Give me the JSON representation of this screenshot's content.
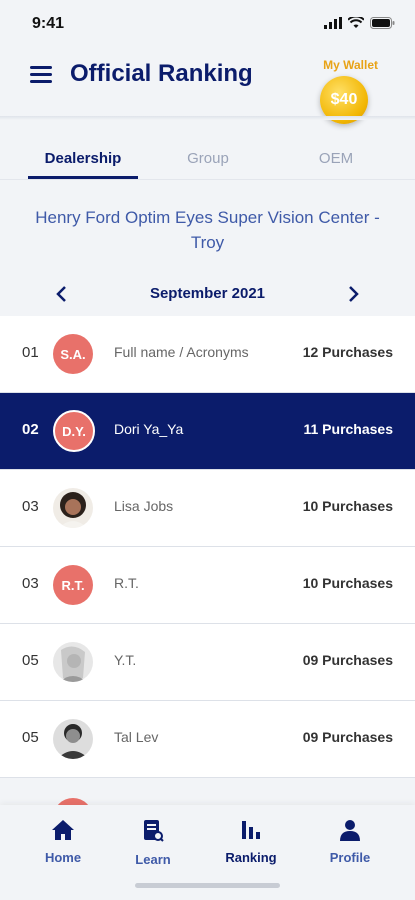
{
  "status": {
    "time": "9:41"
  },
  "header": {
    "title": "Official Ranking",
    "wallet_label": "My Wallet",
    "wallet_amount": "$40"
  },
  "tabs": [
    {
      "label": "Dealership",
      "active": true
    },
    {
      "label": "Group",
      "active": false
    },
    {
      "label": "OEM",
      "active": false
    }
  ],
  "dealer_name": "Henry Ford Optim Eyes Super Vision Center - Troy",
  "month": {
    "label": "September 2021",
    "prev_icon": "chevron-left-icon",
    "next_icon": "chevron-right-icon"
  },
  "rankings": [
    {
      "rank": "01",
      "avatar_text": "S.A.",
      "avatar_type": "initials",
      "name": "Full name / Acronyms",
      "purchases": "12 Purchases",
      "highlight": false
    },
    {
      "rank": "02",
      "avatar_text": "D.Y.",
      "avatar_type": "initials",
      "name": "Dori Ya_Ya",
      "purchases": "11 Purchases",
      "highlight": true
    },
    {
      "rank": "03",
      "avatar_text": "",
      "avatar_type": "photo",
      "name": "Lisa Jobs",
      "purchases": "10 Purchases",
      "highlight": false
    },
    {
      "rank": "03",
      "avatar_text": "R.T.",
      "avatar_type": "initials",
      "name": "R.T.",
      "purchases": "10 Purchases",
      "highlight": false
    },
    {
      "rank": "05",
      "avatar_text": "",
      "avatar_type": "photo",
      "name": "Y.T.",
      "purchases": "09 Purchases",
      "highlight": false
    },
    {
      "rank": "05",
      "avatar_text": "",
      "avatar_type": "photo",
      "name": "Tal Lev",
      "purchases": "09 Purchases",
      "highlight": false
    }
  ],
  "nav": [
    {
      "label": "Home",
      "icon": "home-icon",
      "active": false
    },
    {
      "label": "Learn",
      "icon": "learn-icon",
      "active": false
    },
    {
      "label": "Ranking",
      "icon": "ranking-icon",
      "active": true
    },
    {
      "label": "Profile",
      "icon": "profile-icon",
      "active": false
    }
  ],
  "colors": {
    "primary": "#0b1c6b",
    "accent": "#e8716a",
    "wallet": "#e8a317",
    "link": "#3f5aa8"
  }
}
